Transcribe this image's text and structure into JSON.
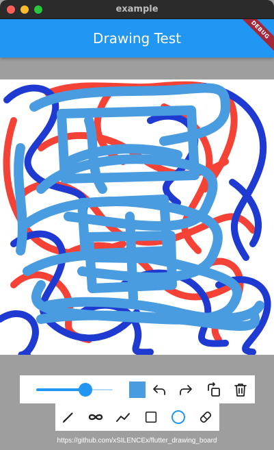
{
  "window": {
    "title": "example"
  },
  "appbar": {
    "title": "Drawing Test",
    "debug_banner": "DEBUG"
  },
  "colors": {
    "app_bar": "#2196f3",
    "stroke_red": "#f44336",
    "stroke_blue": "#1e3ad0",
    "stroke_light_blue": "#4a9ce0",
    "selected_color": "#4a9ce0",
    "canvas": "#ffffff",
    "background": "#9e9e9e"
  },
  "toolbar": {
    "stroke_width_slider": {
      "value_fraction": 0.64
    },
    "color_picker": {
      "current": "#4a9ce0"
    },
    "actions": [
      "undo-icon",
      "redo-icon",
      "rotate-icon",
      "clear-icon"
    ]
  },
  "tools": {
    "items": [
      "pen-icon",
      "smooth-line-icon",
      "polyline-icon",
      "rectangle-icon",
      "circle-icon",
      "eraser-icon"
    ],
    "selected": "circle-icon"
  },
  "footer": {
    "link": "https://github.com/xSILENCEx/flutter_drawing_board"
  }
}
